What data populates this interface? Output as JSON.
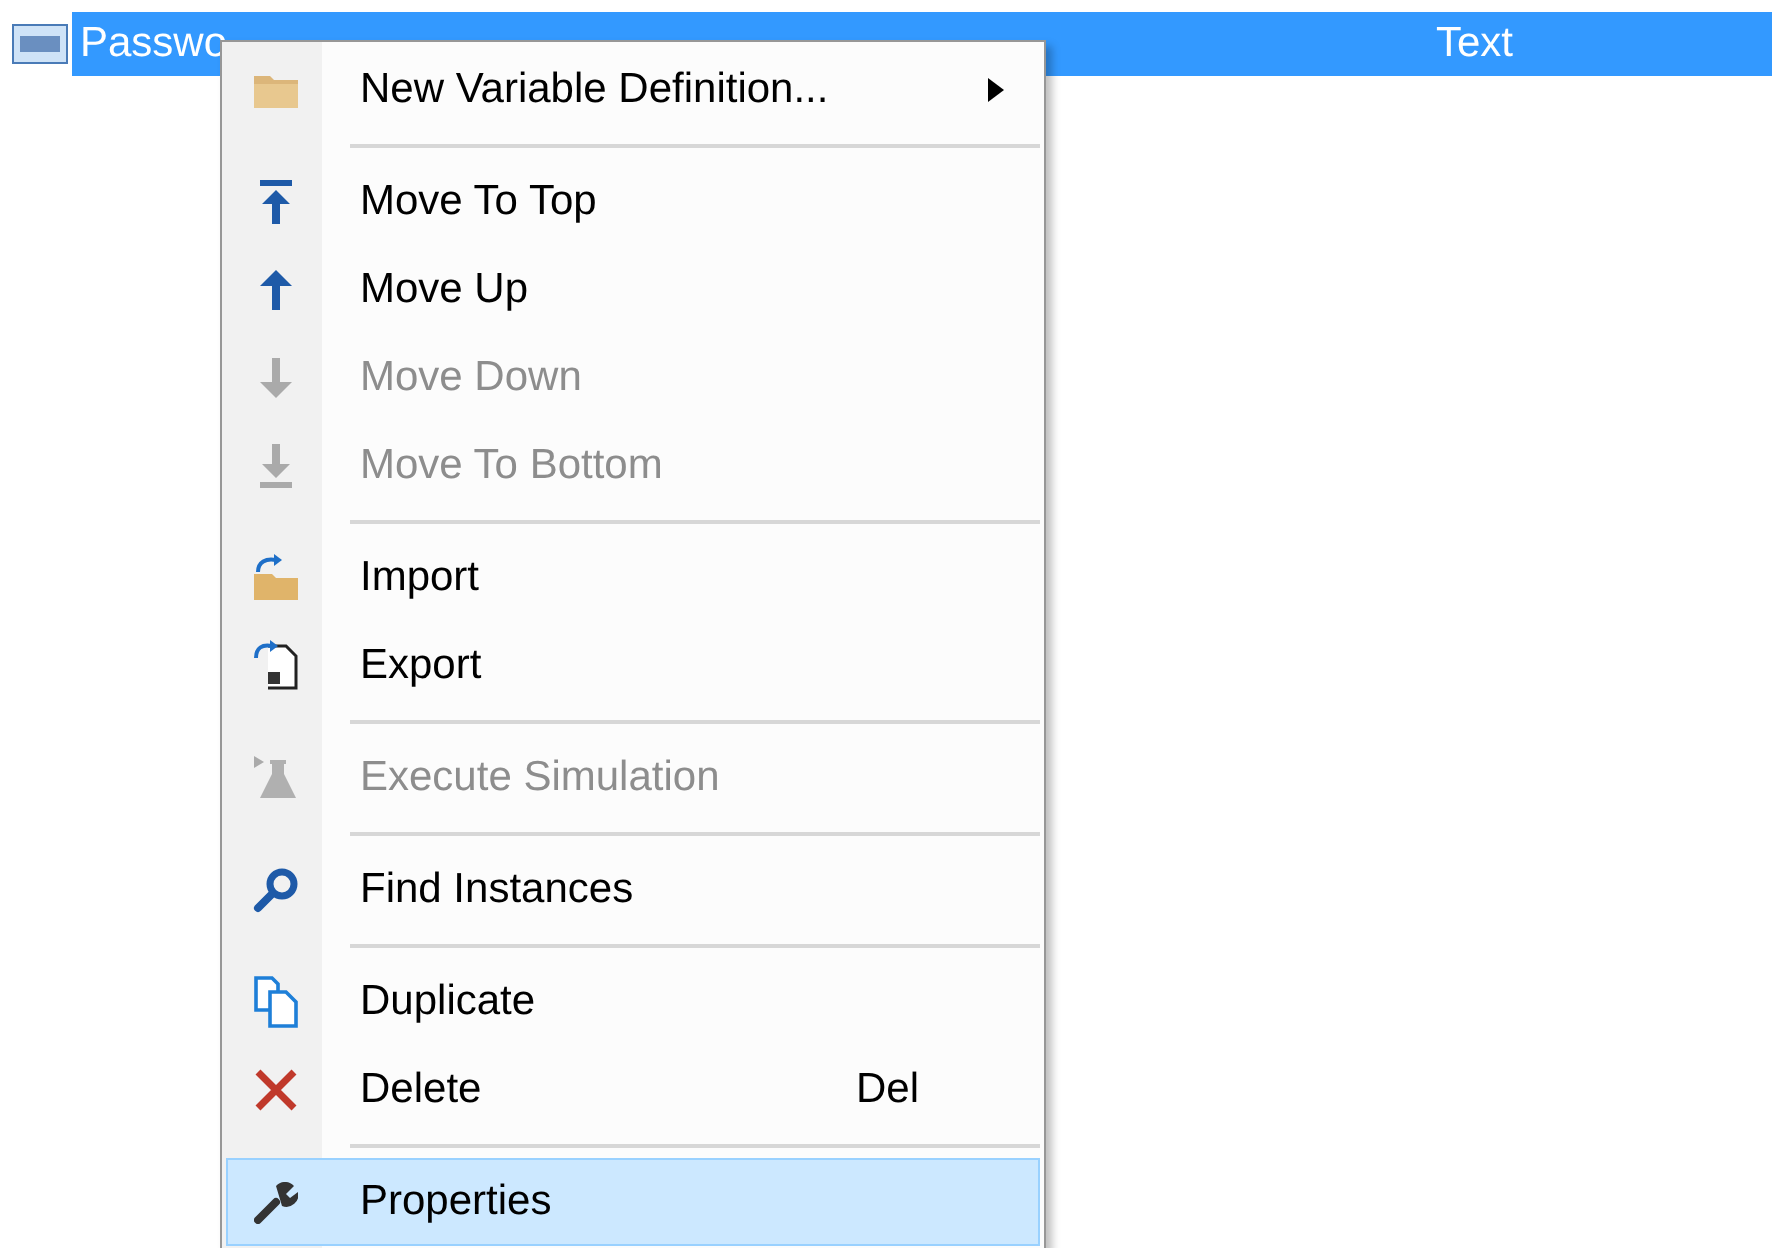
{
  "row": {
    "selected": true,
    "cells": [
      "Passwo",
      "Text"
    ]
  },
  "menu": {
    "items": [
      {
        "kind": "item",
        "label": "New Variable Definition...",
        "disabled": false,
        "selected": false,
        "submenu": true
      },
      {
        "kind": "separator"
      },
      {
        "kind": "item",
        "label": "Move To Top",
        "disabled": false,
        "selected": false
      },
      {
        "kind": "item",
        "label": "Move Up",
        "disabled": false,
        "selected": false
      },
      {
        "kind": "item",
        "label": "Move Down",
        "disabled": true,
        "selected": false
      },
      {
        "kind": "item",
        "label": "Move To Bottom",
        "disabled": true,
        "selected": false
      },
      {
        "kind": "separator"
      },
      {
        "kind": "item",
        "label": "Import",
        "disabled": false,
        "selected": false
      },
      {
        "kind": "item",
        "label": "Export",
        "disabled": false,
        "selected": false
      },
      {
        "kind": "separator"
      },
      {
        "kind": "item",
        "label": "Execute Simulation",
        "disabled": true,
        "selected": false
      },
      {
        "kind": "separator"
      },
      {
        "kind": "item",
        "label": "Find Instances",
        "disabled": false,
        "selected": false
      },
      {
        "kind": "separator"
      },
      {
        "kind": "item",
        "label": "Duplicate",
        "disabled": false,
        "selected": false
      },
      {
        "kind": "item",
        "label": "Delete",
        "disabled": false,
        "selected": false,
        "shortcut": "Del"
      },
      {
        "kind": "separator"
      },
      {
        "kind": "item",
        "label": "Properties",
        "disabled": false,
        "selected": true
      }
    ]
  }
}
